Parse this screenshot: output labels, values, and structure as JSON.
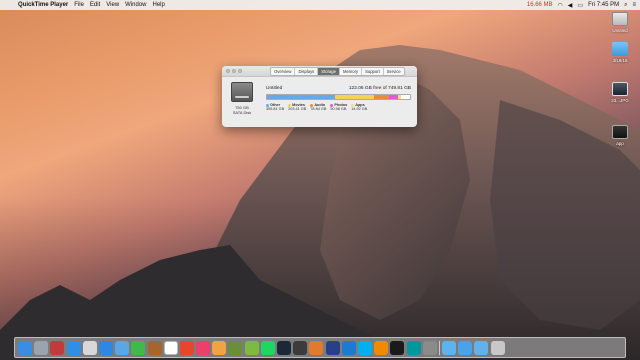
{
  "menubar": {
    "apple": "",
    "app_name": "QuickTime Player",
    "menus": [
      "File",
      "Edit",
      "View",
      "Window",
      "Help"
    ],
    "battery_text": "16.66 MB",
    "time": "Fri 7:45 PM"
  },
  "desktop_icons": [
    {
      "label": "Untitled",
      "kind": "disk-icon"
    },
    {
      "label": "3/18/15",
      "kind": "folder-icon"
    },
    {
      "label": "23...JPG",
      "kind": "image-icon"
    },
    {
      "label": "app",
      "kind": "app-icon"
    }
  ],
  "window": {
    "tabs": [
      "Overview",
      "Displays",
      "Storage",
      "Memory",
      "Support",
      "Service"
    ],
    "active_tab": "Storage",
    "drive": {
      "size_label": "750 GB",
      "type_label": "SATA Disk"
    },
    "storage": {
      "name": "Untitled",
      "free_text": "122.06 GB free of 749.81 GB",
      "segments": [
        {
          "name": "Other",
          "value": "355.81 GB",
          "color": "#6aa7e4",
          "fraction": 0.475
        },
        {
          "name": "Movies",
          "value": "203.41 GB",
          "color": "#f2d54c",
          "fraction": 0.271
        },
        {
          "name": "Audio",
          "value": "78.84 GB",
          "color": "#f08a3a",
          "fraction": 0.105
        },
        {
          "name": "Photos",
          "value": "50.98 GB",
          "color": "#e45ad0",
          "fraction": 0.068
        },
        {
          "name": "Apps",
          "value": "14.92 GB",
          "color": "#f5e07a",
          "fraction": 0.02
        }
      ]
    }
  },
  "dock": {
    "apps": [
      "finder-icon",
      "launchpad-icon",
      "photo-booth-icon",
      "app-store-icon",
      "preview-icon",
      "safari-icon",
      "mail-icon",
      "messages-icon",
      "contacts-icon",
      "calendar-icon",
      "chrome-icon",
      "itunes-icon",
      "photos-icon",
      "minecraft-icon",
      "android-icon",
      "spotify-icon",
      "steam-icon",
      "obs-icon",
      "cinema-icon",
      "ps-icon",
      "xcode-icon",
      "skype-icon",
      "vlc-icon",
      "camera-icon",
      "arduino-icon",
      "system-preferences-icon",
      "folder-icon",
      "downloads-icon",
      "documents-icon",
      "trash-icon"
    ],
    "colors": [
      "#3a8de0",
      "#9aa4b0",
      "#c23b3b",
      "#2f8fe6",
      "#d8d8d8",
      "#2e87e0",
      "#5aa7e6",
      "#3fb94b",
      "#a5652d",
      "#ffffff",
      "#e8452f",
      "#ee3e6a",
      "#f0a342",
      "#6b8e3a",
      "#7dbb40",
      "#1ed760",
      "#1b2838",
      "#3b3b3b",
      "#e07a2c",
      "#2a3f8a",
      "#1c7bd1",
      "#00aff0",
      "#f08a00",
      "#1a1a1a",
      "#00979d",
      "#8b8b8b",
      "#5fb1ef",
      "#4aa3e8",
      "#62b0ec",
      "#c8c8c8"
    ]
  }
}
